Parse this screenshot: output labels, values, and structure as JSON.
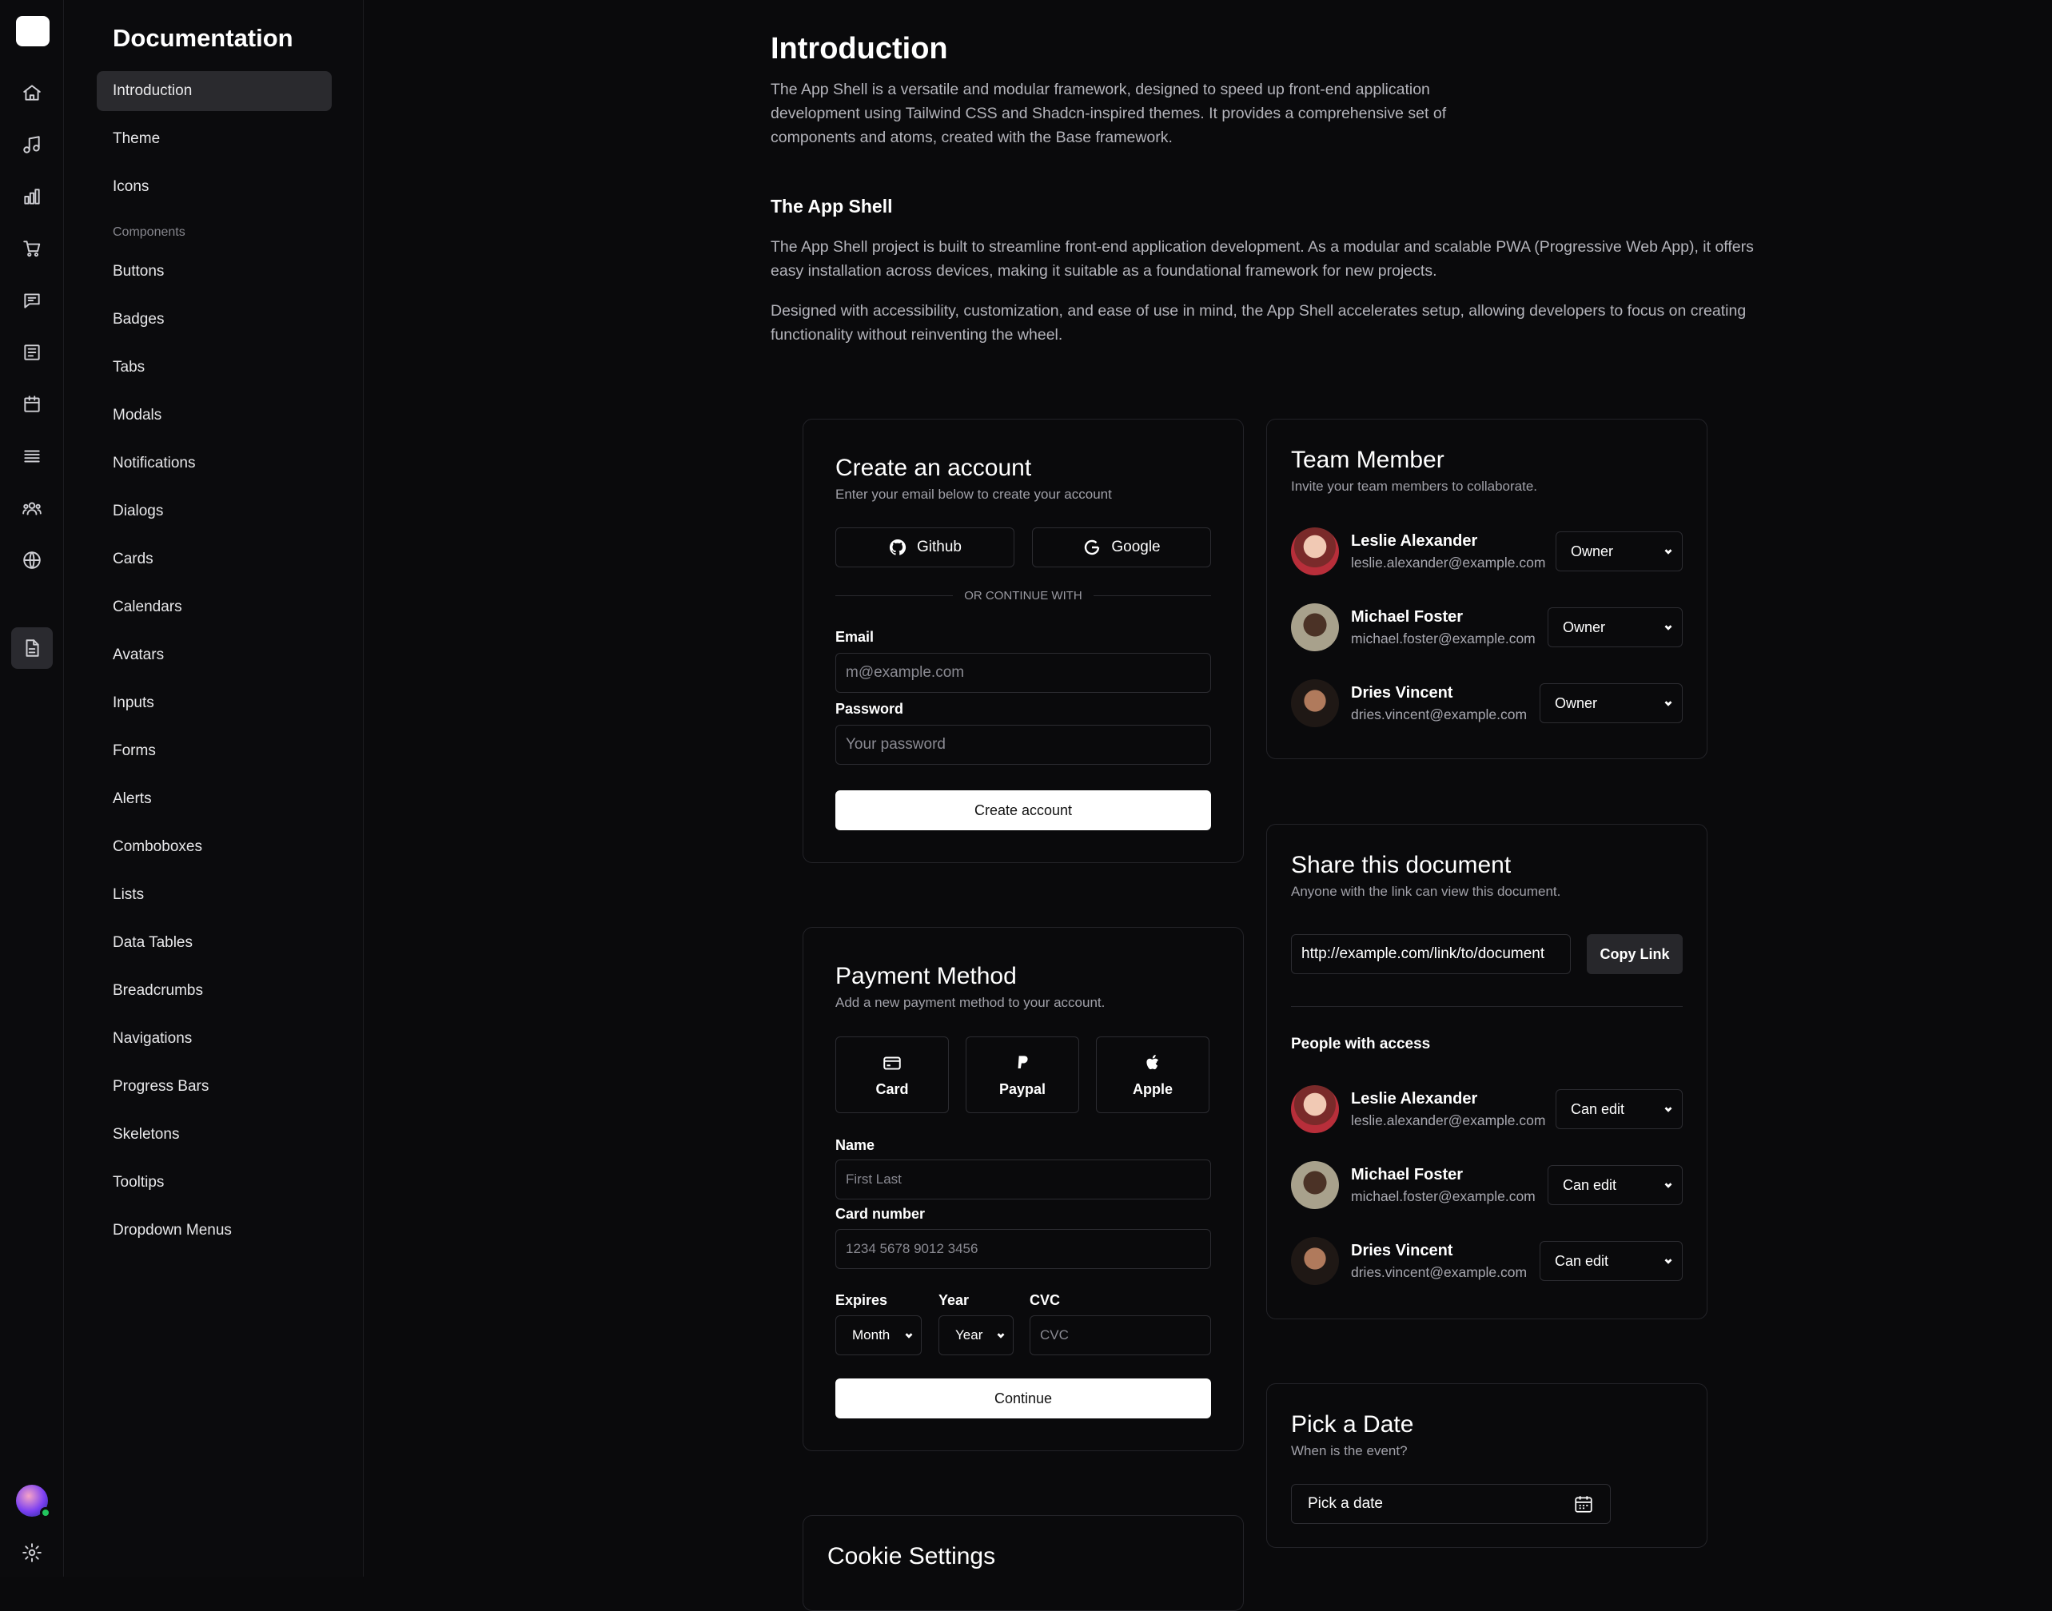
{
  "sidebar": {
    "title": "Documentation",
    "items_top": [
      "Introduction",
      "Theme",
      "Icons"
    ],
    "section_label": "Components",
    "items": [
      "Buttons",
      "Badges",
      "Tabs",
      "Modals",
      "Notifications",
      "Dialogs",
      "Cards",
      "Calendars",
      "Avatars",
      "Inputs",
      "Forms",
      "Alerts",
      "Comboboxes",
      "Lists",
      "Data Tables",
      "Breadcrumbs",
      "Navigations",
      "Progress Bars",
      "Skeletons",
      "Tooltips",
      "Dropdown Menus"
    ]
  },
  "rail_icons": [
    "home-icon",
    "music-icon",
    "chart-icon",
    "cart-icon",
    "chat-icon",
    "news-icon",
    "calendar-icon",
    "list-icon",
    "users-icon",
    "globe-icon",
    "document-icon",
    "settings-icon"
  ],
  "intro": {
    "title": "Introduction",
    "p1": "The App Shell is a versatile and modular framework, designed to speed up front-end application development using Tailwind CSS and Shadcn-inspired themes. It provides a comprehensive set of components and atoms, created with the Base framework.",
    "subtitle": "The App Shell",
    "p2": "The App Shell project is built to streamline front-end application development. As a modular and scalable PWA (Progressive Web App), it offers easy installation across devices, making it suitable as a foundational framework for new projects.",
    "p3": "Designed with accessibility, customization, and ease of use in mind, the App Shell accelerates setup, allowing developers to focus on creating functionality without reinventing the wheel."
  },
  "create_account": {
    "title": "Create an account",
    "subtitle": "Enter your email below to create your account",
    "github": "Github",
    "google": "Google",
    "divider": "OR CONTINUE WITH",
    "email_label": "Email",
    "email_placeholder": "m@example.com",
    "password_label": "Password",
    "password_placeholder": "Your password",
    "submit": "Create account"
  },
  "team": {
    "title": "Team Member",
    "subtitle": "Invite your team members to collaborate.",
    "members": [
      {
        "name": "Leslie Alexander",
        "email": "leslie.alexander@example.com",
        "role": "Owner"
      },
      {
        "name": "Michael Foster",
        "email": "michael.foster@example.com",
        "role": "Owner"
      },
      {
        "name": "Dries Vincent",
        "email": "dries.vincent@example.com",
        "role": "Owner"
      }
    ]
  },
  "share": {
    "title": "Share this document",
    "subtitle": "Anyone with the link can view this document.",
    "link": "http://example.com/link/to/document",
    "copy": "Copy Link",
    "people_title": "People with access",
    "people": [
      {
        "name": "Leslie Alexander",
        "email": "leslie.alexander@example.com",
        "role": "Can edit"
      },
      {
        "name": "Michael Foster",
        "email": "michael.foster@example.com",
        "role": "Can edit"
      },
      {
        "name": "Dries Vincent",
        "email": "dries.vincent@example.com",
        "role": "Can edit"
      }
    ]
  },
  "payment": {
    "title": "Payment Method",
    "subtitle": "Add a new payment method to your account.",
    "options": [
      "Card",
      "Paypal",
      "Apple"
    ],
    "name_label": "Name",
    "name_placeholder": "First Last",
    "card_label": "Card number",
    "card_placeholder": "1234 5678 9012 3456",
    "expires_label": "Expires",
    "month": "Month",
    "year_label": "Year",
    "year": "Year",
    "cvc_label": "CVC",
    "cvc_placeholder": "CVC",
    "submit": "Continue"
  },
  "date": {
    "title": "Pick a Date",
    "subtitle": "When is the event?",
    "button": "Pick a date"
  },
  "cookie": {
    "title": "Cookie Settings"
  }
}
